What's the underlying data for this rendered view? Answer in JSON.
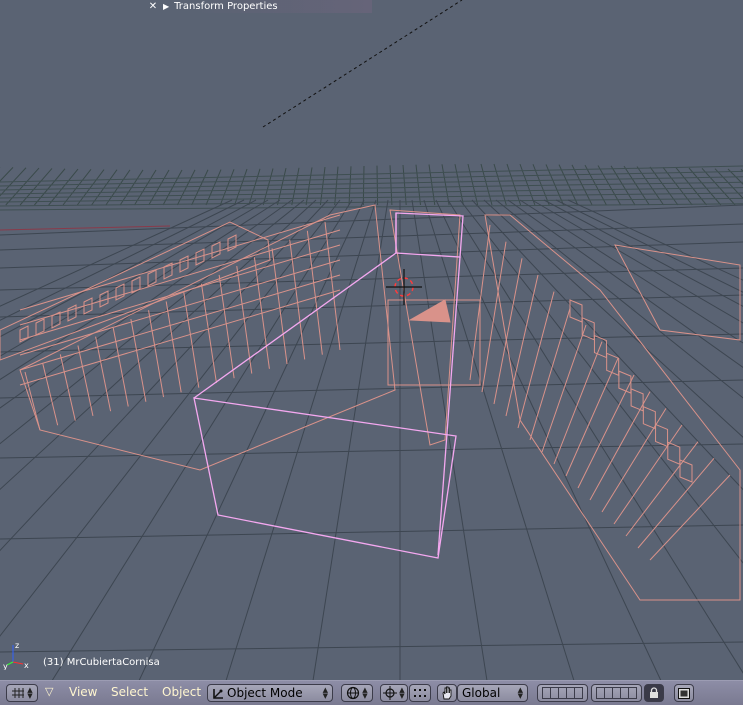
{
  "panel": {
    "title": "Transform Properties",
    "close_glyph": "✕",
    "expand_glyph": "▶"
  },
  "status": {
    "object_label": "(31) MrCubiertaCornisa"
  },
  "axis": {
    "x": "x",
    "y": "y",
    "z": "z"
  },
  "header": {
    "menus": [
      "View",
      "Select",
      "Object"
    ],
    "mode": "Object Mode",
    "orientation": "Global",
    "dropdown_glyph": "▽"
  },
  "icons": {
    "editor_type": "grid-icon",
    "draw_type": "sphere-icon",
    "pivot": "crosshair-icon",
    "transform": "hand-icon",
    "lock": "lock-icon",
    "render": "image-icon"
  },
  "colors": {
    "background": "#5a6373",
    "wire": "#d9928a",
    "selected_wire": "#f4a8f0",
    "header": "#8d8da6",
    "menu_text": "#fff6d0"
  }
}
